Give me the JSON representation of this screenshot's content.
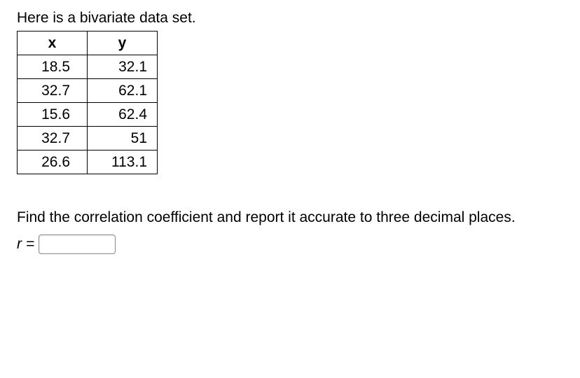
{
  "intro_text": "Here is a bivariate data set.",
  "table": {
    "header_x": "x",
    "header_y": "y",
    "rows": [
      {
        "x": "18.5",
        "y": "32.1"
      },
      {
        "x": "32.7",
        "y": "62.1"
      },
      {
        "x": "15.6",
        "y": "62.4"
      },
      {
        "x": "32.7",
        "y": "51"
      },
      {
        "x": "26.6",
        "y": "113.1"
      }
    ]
  },
  "prompt_text": "Find the correlation coefficient and report it accurate to three decimal places.",
  "answer_label": "r =",
  "answer_value": "",
  "chart_data": {
    "type": "table",
    "title": "Bivariate data set",
    "columns": [
      "x",
      "y"
    ],
    "data": [
      [
        18.5,
        32.1
      ],
      [
        32.7,
        62.1
      ],
      [
        15.6,
        62.4
      ],
      [
        32.7,
        51
      ],
      [
        26.6,
        113.1
      ]
    ]
  }
}
